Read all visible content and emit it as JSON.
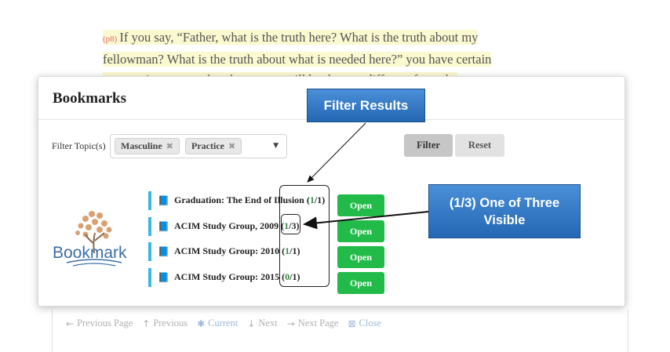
{
  "background": {
    "paragraph_num": "(p8)",
    "lines": [
      "If you say, “Father, what is the truth here? What is the truth about my",
      "fellowman? What is the truth about what is needed here?” you have certain",
      "expectations as to what the answer will be that are different from the"
    ]
  },
  "footer": {
    "prev_page": "Previous Page",
    "previous": "Previous",
    "current": "Current",
    "next": "Next",
    "next_page": "Next Page",
    "close": "Close"
  },
  "modal": {
    "title": "Bookmarks",
    "filter_label": "Filter Topic(s)",
    "chips": [
      "Masculine",
      "Practice"
    ],
    "filter_button": "Filter",
    "reset_button": "Reset",
    "logo_text": "Bookmark",
    "open_label": "Open",
    "bookmarks": [
      {
        "title": "Graduation: The End of Illusion",
        "shown": "1",
        "total": "1"
      },
      {
        "title": "ACIM Study Group, 2009",
        "shown": "1",
        "total": "3"
      },
      {
        "title": "ACIM Study Group: 2010",
        "shown": "1",
        "total": "1"
      },
      {
        "title": "ACIM Study Group: 2015",
        "shown": "0",
        "total": "1"
      }
    ]
  },
  "annotations": {
    "filter_results": "Filter Results",
    "one_of_three_line1": "(1/3) One of Three",
    "one_of_three_line2": "Visible"
  },
  "colors": {
    "accent_green": "#22bb4a",
    "count_green": "#2e8b3a",
    "bar_blue": "#3bb8e2",
    "callout_blue": "#2f78c6"
  }
}
